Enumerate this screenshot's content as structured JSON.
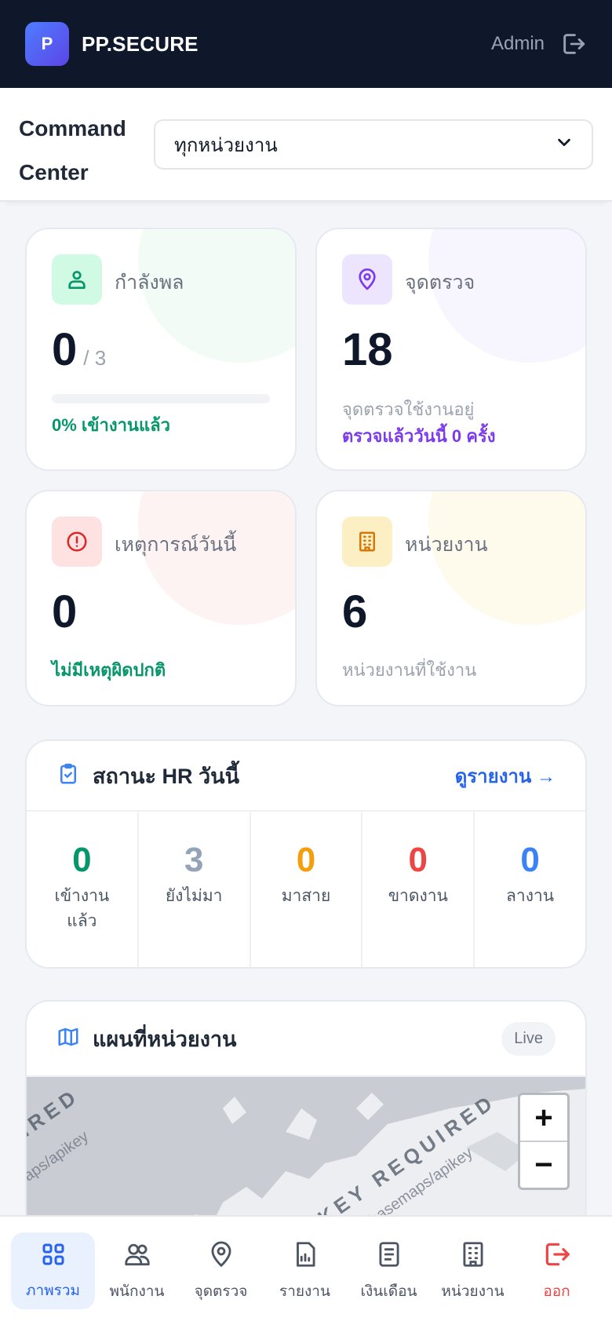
{
  "header": {
    "logo_letter": "P",
    "brand": "PP.SECURE",
    "user": "Admin"
  },
  "command_center": {
    "title": "Command Center",
    "unit_select": "ทุกหน่วยงาน"
  },
  "stats": {
    "manpower": {
      "label": "กำลังพล",
      "value": "0",
      "total": "/ 3",
      "sub": "0% เข้างานแล้ว",
      "progress_percent": 0
    },
    "checkpoints": {
      "label": "จุดตรวจ",
      "value": "18",
      "sub1": "จุดตรวจใช้งานอยู่",
      "sub2": "ตรวจแล้ววันนี้ 0 ครั้ง"
    },
    "incidents": {
      "label": "เหตุการณ์วันนี้",
      "value": "0",
      "sub": "ไม่มีเหตุผิดปกติ"
    },
    "units": {
      "label": "หน่วยงาน",
      "value": "6",
      "sub": "หน่วยงานที่ใช้งาน"
    }
  },
  "hr_status": {
    "title": "สถานะ HR วันนี้",
    "link": "ดูรายงาน →",
    "items": [
      {
        "value": "0",
        "label": "เข้างานแล้ว",
        "color": "#059669"
      },
      {
        "value": "3",
        "label": "ยังไม่มา",
        "color": "#94a3b8"
      },
      {
        "value": "0",
        "label": "มาสาย",
        "color": "#f59e0b"
      },
      {
        "value": "0",
        "label": "ขาดงาน",
        "color": "#ef4444"
      },
      {
        "value": "0",
        "label": "ลางาน",
        "color": "#3b82f6"
      }
    ]
  },
  "map": {
    "title": "แผนที่หน่วยงาน",
    "badge": "Live",
    "watermark_left": "IRED",
    "watermark_left_small": "aps/apikey",
    "watermark_main": "KEY REQUIRED",
    "watermark_main_small": "/basemaps/apikey",
    "zoom_in": "+",
    "zoom_out": "−"
  },
  "nav": {
    "items": [
      {
        "label": "ภาพรวม",
        "icon": "grid-icon",
        "active": true
      },
      {
        "label": "พนักงาน",
        "icon": "users-icon"
      },
      {
        "label": "จุดตรวจ",
        "icon": "map-pin-icon"
      },
      {
        "label": "รายงาน",
        "icon": "report-chart-icon"
      },
      {
        "label": "เงินเดือน",
        "icon": "document-icon"
      },
      {
        "label": "หน่วยงาน",
        "icon": "building-icon"
      },
      {
        "label": "ออก",
        "icon": "logout-icon"
      }
    ]
  },
  "colors": {
    "header_bg": "#0f172a",
    "accent": "#2563eb",
    "success": "#059669",
    "purple": "#7c3aed",
    "danger": "#ef4444"
  }
}
